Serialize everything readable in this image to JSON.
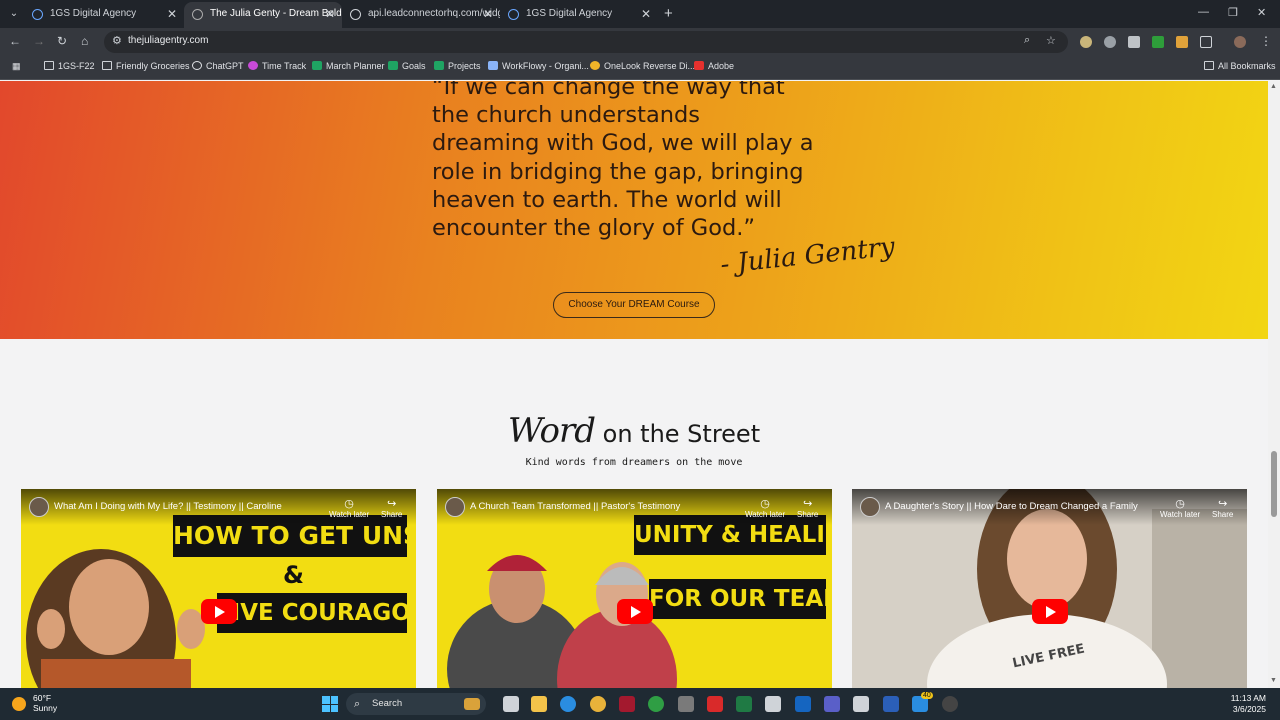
{
  "browser": {
    "tabs": [
      {
        "label": "1GS Digital Agency",
        "active": false
      },
      {
        "label": "The Julia Genty - Dream Bold, L",
        "active": true
      },
      {
        "label": "api.leadconnectorhq.com/widg",
        "active": false
      },
      {
        "label": "1GS Digital Agency",
        "active": false
      }
    ],
    "url": "thejuliagentry.com",
    "bookmarks": [
      {
        "label": "1GS-F22",
        "icon": "folder-icon"
      },
      {
        "label": "Friendly Groceries",
        "icon": "folder-icon"
      },
      {
        "label": "ChatGPT",
        "icon": "chatgpt-icon"
      },
      {
        "label": "Time Track",
        "icon": "clock-icon"
      },
      {
        "label": "March Planner",
        "icon": "sheets-icon"
      },
      {
        "label": "Goals",
        "icon": "sheets-icon"
      },
      {
        "label": "Projects",
        "icon": "sheets-icon"
      },
      {
        "label": "WorkFlowy - Organi...",
        "icon": "workflowy-icon"
      },
      {
        "label": "OneLook Reverse Di...",
        "icon": "sun-icon"
      },
      {
        "label": "Adobe",
        "icon": "adobe-icon"
      }
    ],
    "all_bookmarks": "All Bookmarks"
  },
  "hero": {
    "quote_lines": [
      "“If we can change the way that",
      "the church understands",
      "dreaming with God, we will play a",
      "role in bridging the gap, bringing",
      "heaven to earth. The world will",
      "encounter the glory of God.”"
    ],
    "signature": "- Julia Gentry",
    "cta_label": "Choose Your DREAM Course",
    "gradient": [
      "#e2482c",
      "#e9821f",
      "#f2d613"
    ]
  },
  "section": {
    "heading_script": "Word",
    "heading_main": " on the Street",
    "subheading": "Kind words from dreamers on the move"
  },
  "videos": [
    {
      "title": "What Am I Doing with My Life? || Testimony || Caroline",
      "banner_1": "HOW TO GET UNSTUCK",
      "amp": "&",
      "banner_2": "LIVE COURAGOUS",
      "watch_later": "Watch later",
      "share": "Share"
    },
    {
      "title": "A Church Team Transformed || Pastor's Testimony",
      "banner_1": "UNITY & HEALING",
      "banner_2": "FOR OUR TEAM",
      "watch_later": "Watch later",
      "share": "Share"
    },
    {
      "title": "A Daughter's Story || How Dare to Dream Changed a Family",
      "shirt_text": "LIVE FREE",
      "watch_later": "Watch later",
      "share": "Share"
    }
  ],
  "taskbar": {
    "temperature": "60°F",
    "condition": "Sunny",
    "search_placeholder": "Search",
    "time": "11:13 AM",
    "date": "3/6/2025",
    "badge_count": "40"
  }
}
